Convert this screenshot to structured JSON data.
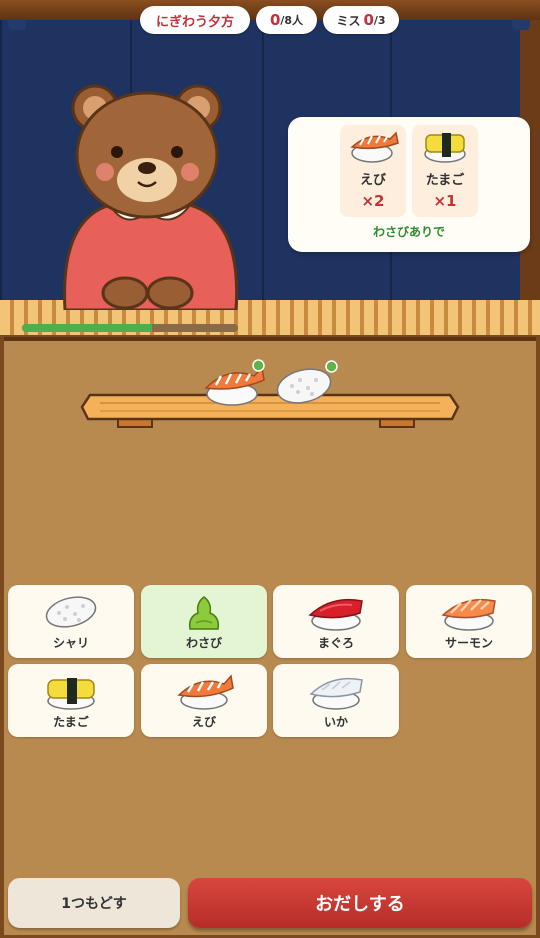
{
  "hud": {
    "stage_title": "にぎわう夕方",
    "served": "0",
    "served_total": "/8人",
    "miss_label": "ミス",
    "miss_count": "0",
    "miss_total": "/3"
  },
  "customer": {
    "icon": "bear-customer-icon",
    "patience_fraction": 0.6
  },
  "order": {
    "items": [
      {
        "name": "えび",
        "qty": "×2",
        "icon": "shrimp-sushi-icon"
      },
      {
        "name": "たまご",
        "qty": "×1",
        "icon": "tamago-sushi-icon"
      }
    ],
    "note": "わさびありで"
  },
  "plate": {
    "items": [
      {
        "icon": "shrimp-sushi-icon"
      },
      {
        "icon": "rice-shari-icon"
      }
    ]
  },
  "menu": {
    "items": [
      {
        "label": "シャリ",
        "icon": "rice-shari-icon"
      },
      {
        "label": "わさび",
        "icon": "wasabi-icon",
        "selected": true
      },
      {
        "label": "まぐろ",
        "icon": "tuna-sushi-icon"
      },
      {
        "label": "サーモン",
        "icon": "salmon-sushi-icon"
      },
      {
        "label": "たまご",
        "icon": "tamago-sushi-icon"
      },
      {
        "label": "えび",
        "icon": "shrimp-sushi-icon"
      },
      {
        "label": "いか",
        "icon": "squid-sushi-icon"
      }
    ]
  },
  "actions": {
    "undo_label": "1つもどす",
    "serve_label": "おだしする"
  },
  "colors": {
    "accent_red": "#c0333a",
    "serve_button": "#c8372f",
    "note_green": "#2e8b2e",
    "curtain_navy": "#1f3361"
  }
}
